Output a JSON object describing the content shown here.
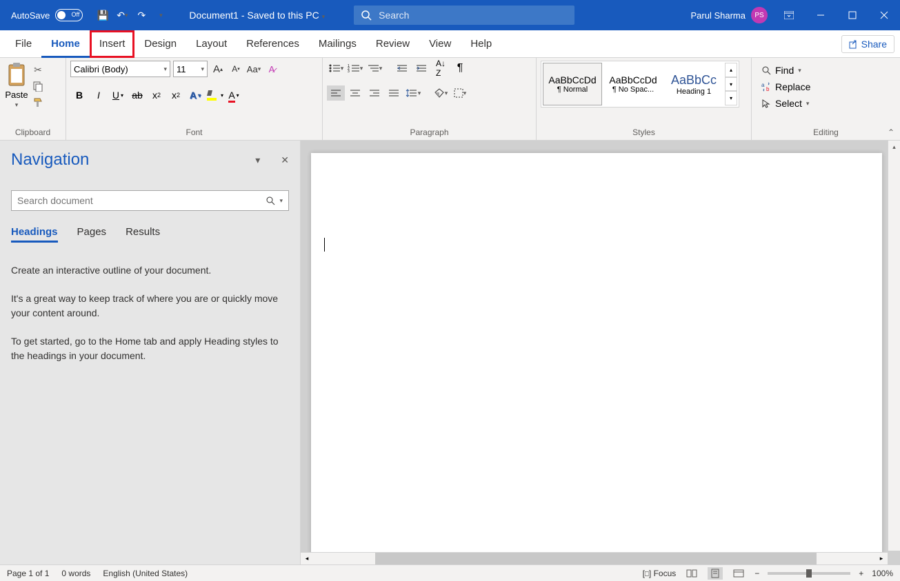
{
  "titlebar": {
    "autosave_label": "AutoSave",
    "autosave_state": "Off",
    "document_title": "Document1 - Saved to this PC",
    "search_placeholder": "Search",
    "user_name": "Parul Sharma",
    "user_initials": "PS"
  },
  "tabs": {
    "file": "File",
    "home": "Home",
    "insert": "Insert",
    "design": "Design",
    "layout": "Layout",
    "references": "References",
    "mailings": "Mailings",
    "review": "Review",
    "view": "View",
    "help": "Help",
    "share": "Share"
  },
  "ribbon": {
    "clipboard": {
      "label": "Clipboard",
      "paste": "Paste"
    },
    "font": {
      "label": "Font",
      "name": "Calibri (Body)",
      "size": "11"
    },
    "paragraph": {
      "label": "Paragraph"
    },
    "styles": {
      "label": "Styles",
      "items": [
        {
          "preview": "AaBbCcDd",
          "name": "¶ Normal"
        },
        {
          "preview": "AaBbCcDd",
          "name": "¶ No Spac..."
        },
        {
          "preview": "AaBbCc",
          "name": "Heading 1"
        }
      ]
    },
    "editing": {
      "label": "Editing",
      "find": "Find",
      "replace": "Replace",
      "select": "Select"
    }
  },
  "navigation": {
    "title": "Navigation",
    "search_placeholder": "Search document",
    "tabs": {
      "headings": "Headings",
      "pages": "Pages",
      "results": "Results"
    },
    "hint1": "Create an interactive outline of your document.",
    "hint2": "It's a great way to keep track of where you are or quickly move your content around.",
    "hint3": "To get started, go to the Home tab and apply Heading styles to the headings in your document."
  },
  "statusbar": {
    "page": "Page 1 of 1",
    "words": "0 words",
    "language": "English (United States)",
    "focus": "Focus",
    "zoom": "100%"
  }
}
